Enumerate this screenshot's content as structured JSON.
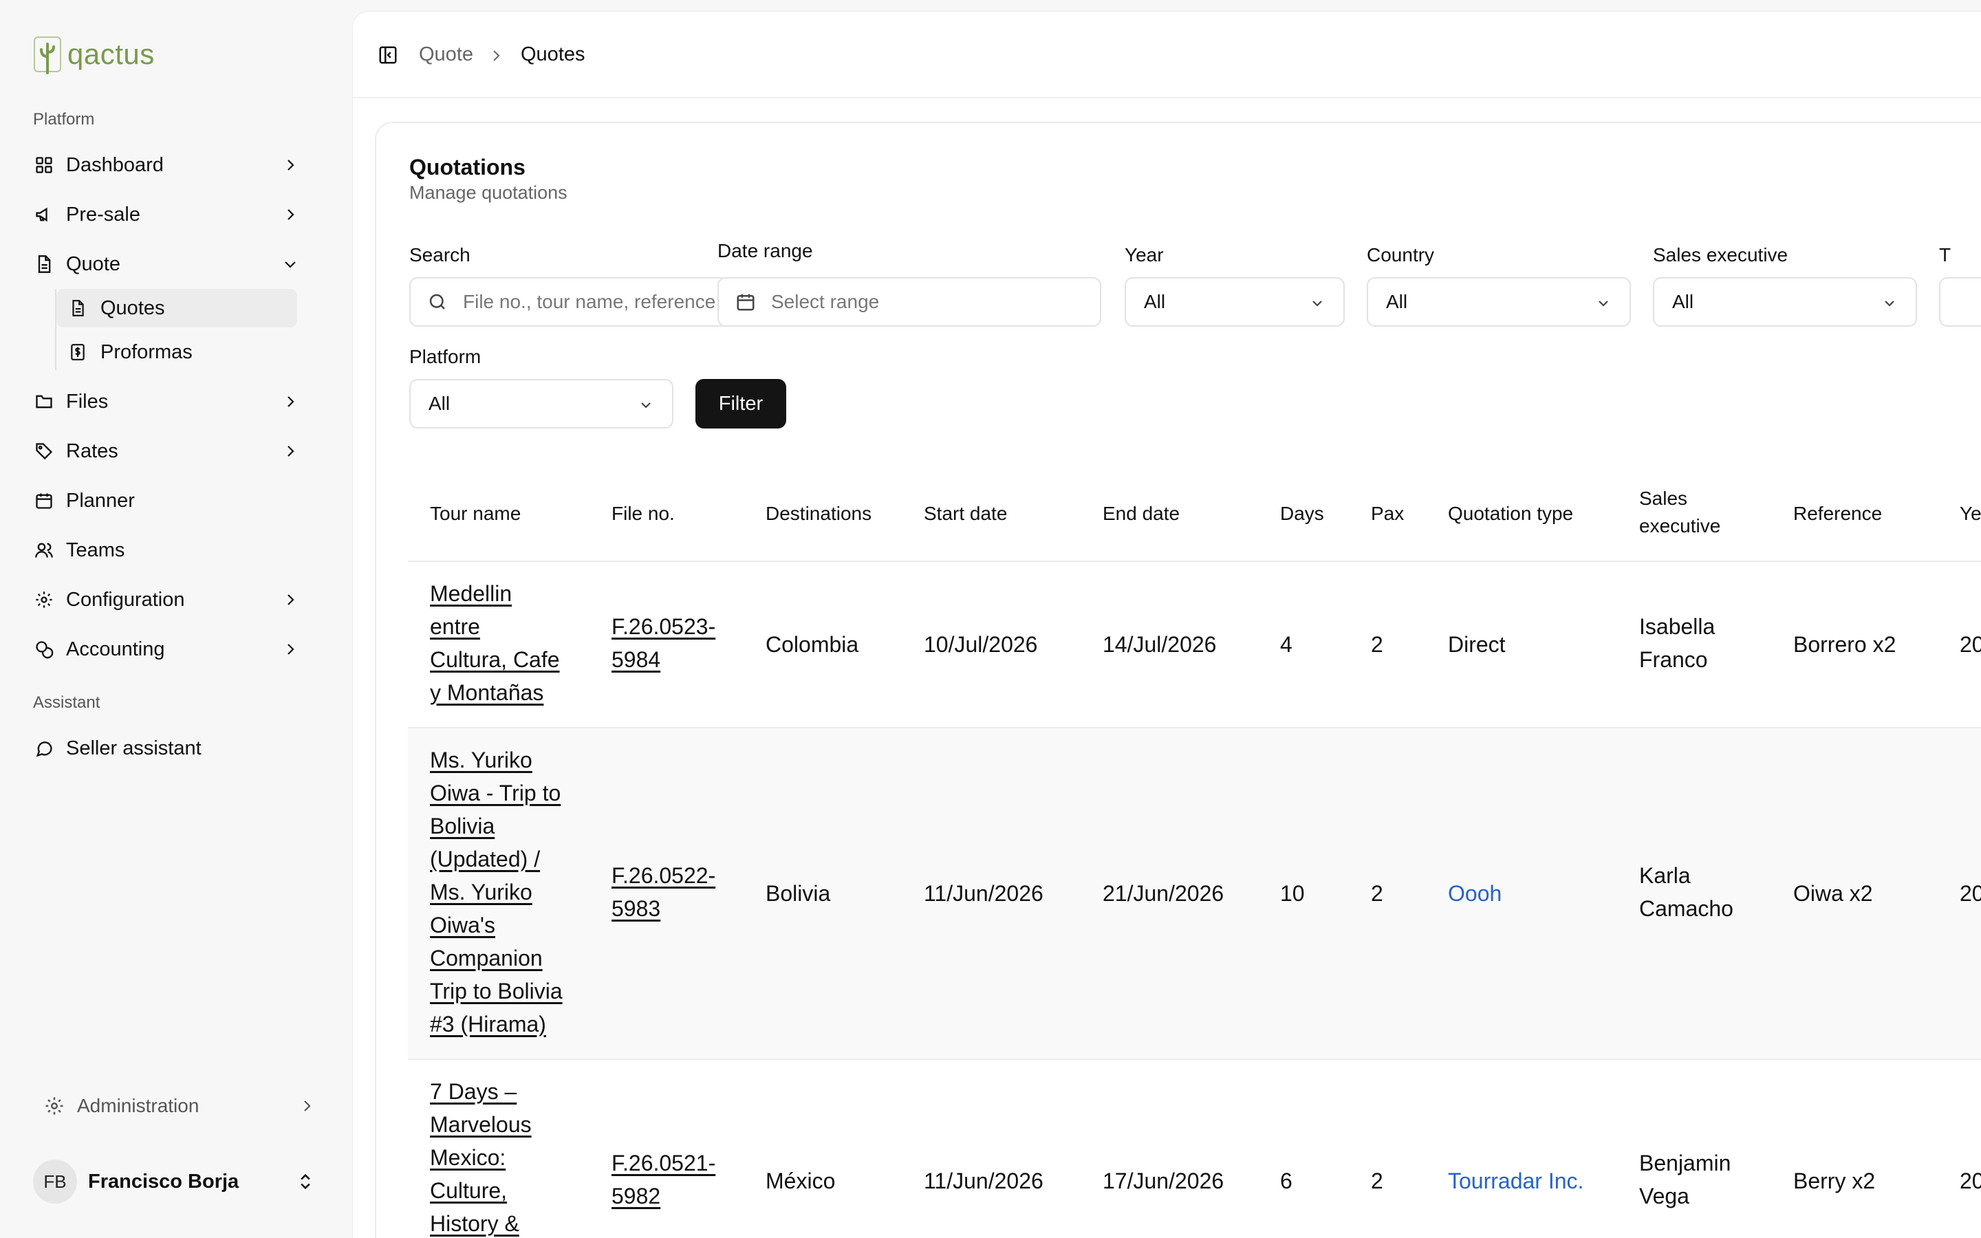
{
  "app": {
    "logo_text": "qactus"
  },
  "sidebar": {
    "platform_label": "Platform",
    "assistant_label": "Assistant",
    "items": [
      {
        "label": "Dashboard",
        "icon": "grid-icon"
      },
      {
        "label": "Pre-sale",
        "icon": "megaphone-icon"
      },
      {
        "label": "Quote",
        "icon": "document-icon"
      },
      {
        "label": "Files",
        "icon": "folder-icon"
      },
      {
        "label": "Rates",
        "icon": "tag-icon"
      },
      {
        "label": "Planner",
        "icon": "calendar-icon"
      },
      {
        "label": "Teams",
        "icon": "users-icon"
      },
      {
        "label": "Configuration",
        "icon": "gear-icon"
      },
      {
        "label": "Accounting",
        "icon": "coins-icon"
      }
    ],
    "quote_sub": [
      {
        "label": "Quotes",
        "icon": "document-icon",
        "active": true
      },
      {
        "label": "Proformas",
        "icon": "dollar-document-icon",
        "active": false
      }
    ],
    "assistant_item": {
      "label": "Seller assistant",
      "icon": "chat-icon"
    },
    "admin": {
      "label": "Administration",
      "icon": "gear-icon"
    },
    "user": {
      "initials": "FB",
      "name": "Francisco Borja"
    }
  },
  "breadcrumb": {
    "parent": "Quote",
    "current": "Quotes"
  },
  "card": {
    "title": "Quotations",
    "subtitle": "Manage quotations"
  },
  "filters": {
    "search": {
      "label": "Search",
      "placeholder": "File no., tour name, reference"
    },
    "date_range": {
      "label": "Date range",
      "placeholder": "Select range"
    },
    "year": {
      "label": "Year",
      "value": "All"
    },
    "country": {
      "label": "Country",
      "value": "All"
    },
    "sales_executive": {
      "label": "Sales executive",
      "value": "All"
    },
    "next_label": "T",
    "platform": {
      "label": "Platform",
      "value": "All"
    },
    "filter_button": "Filter"
  },
  "table": {
    "headers": {
      "tour_name": "Tour name",
      "file_no": "File no.",
      "destinations": "Destinations",
      "start_date": "Start date",
      "end_date": "End date",
      "days": "Days",
      "pax": "Pax",
      "quotation_type": "Quotation type",
      "sales_executive_1": "Sales",
      "sales_executive_2": "executive",
      "reference": "Reference",
      "year": "Ye"
    },
    "rows": [
      {
        "tour_lines": [
          "Medellin",
          "entre",
          "Cultura, Cafe",
          "y Montañas"
        ],
        "file_lines": [
          "F.26.0523-",
          "5984"
        ],
        "destination": "Colombia",
        "start_date": "10/Jul/2026",
        "end_date": "14/Jul/2026",
        "days": "4",
        "pax": "2",
        "quotation_type": "Direct",
        "exec_lines": [
          "Isabella",
          "Franco"
        ],
        "reference": "Borrero x2",
        "year": "20"
      },
      {
        "tour_lines": [
          "Ms. Yuriko",
          "Oiwa - Trip to",
          "Bolivia",
          "(Updated) /",
          "Ms. Yuriko",
          "Oiwa's",
          "Companion",
          "Trip to Bolivia",
          "#3 (Hirama)"
        ],
        "file_lines": [
          "F.26.0522-",
          "5983"
        ],
        "destination": "Bolivia",
        "start_date": "11/Jun/2026",
        "end_date": "21/Jun/2026",
        "days": "10",
        "pax": "2",
        "quotation_type": "Oooh",
        "exec_lines": [
          "Karla",
          "Camacho"
        ],
        "reference": "Oiwa x2",
        "year": "20"
      },
      {
        "tour_lines": [
          "7 Days –",
          "Marvelous",
          "Mexico:",
          "Culture,",
          "History &"
        ],
        "file_lines": [
          "F.26.0521-",
          "5982"
        ],
        "destination": "México",
        "start_date": "11/Jun/2026",
        "end_date": "17/Jun/2026",
        "days": "6",
        "pax": "2",
        "quotation_type": "Tourradar Inc.",
        "exec_lines": [
          "Benjamin",
          "Vega"
        ],
        "reference": "Berry x2",
        "year": "20"
      }
    ]
  },
  "colors": {
    "link_blue": "#2563c9",
    "logo_green": "#7a9a4a",
    "button_dark": "#141414"
  }
}
